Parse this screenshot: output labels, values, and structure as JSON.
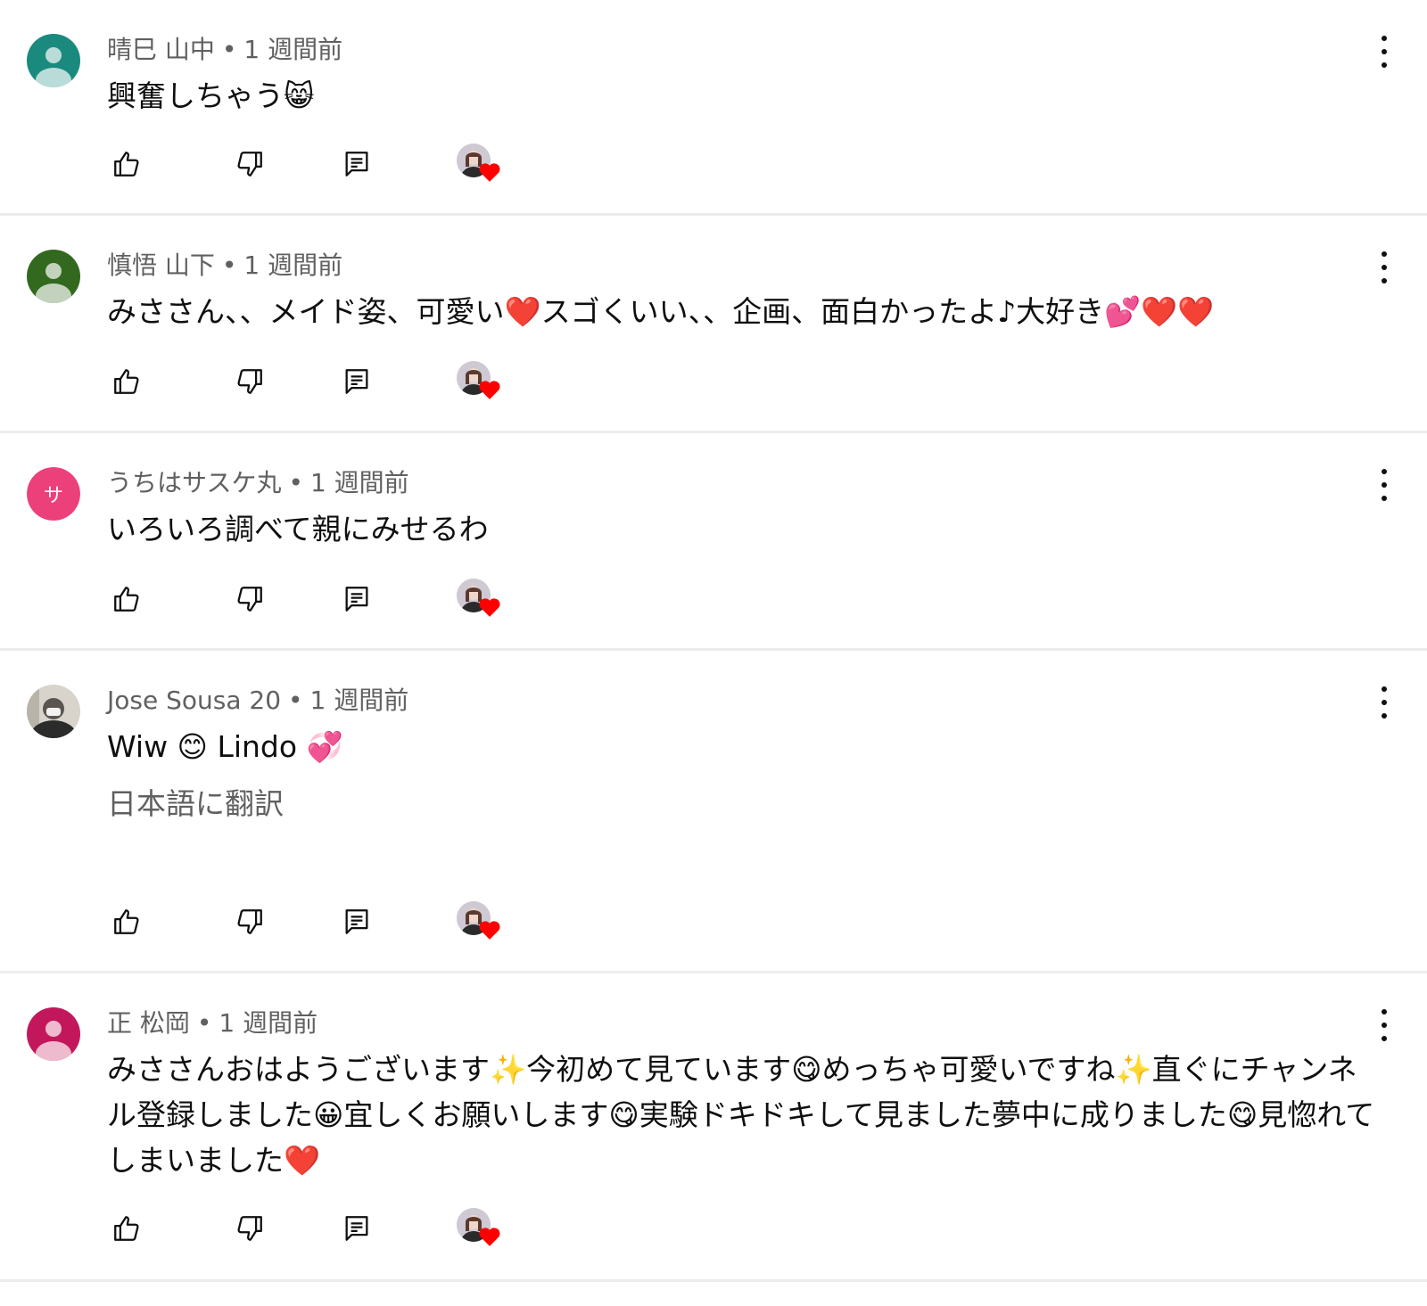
{
  "comments": [
    {
      "author": "晴巳 山中",
      "time": "1 週間前",
      "avatar_type": "person",
      "avatar_color": "#1a8a7e",
      "text": "興奮しちゃう😸",
      "translate": ""
    },
    {
      "author": "慎悟 山下",
      "time": "1 週間前",
      "avatar_type": "person",
      "avatar_color": "#33691e",
      "text": "みささん、、メイド姿、可愛い❤️スゴくいい、、企画、面白かったよ♪大好き💕❤️❤️",
      "translate": ""
    },
    {
      "author": "うちはサスケ丸",
      "time": "1 週間前",
      "avatar_type": "letter",
      "avatar_letter": "サ",
      "avatar_color": "#ec407a",
      "text": "いろいろ調べて親にみせるわ",
      "translate": ""
    },
    {
      "author": "Jose Sousa 20",
      "time": "1 週間前",
      "avatar_type": "photo",
      "avatar_color": "#5a5550",
      "text": "Wiw 😊 Lindo 💞",
      "translate": "日本語に翻訳"
    },
    {
      "author": "正 松岡",
      "time": "1 週間前",
      "avatar_type": "person",
      "avatar_color": "#c2185b",
      "text": "みささんおはようございます✨今初めて見ています😋めっちゃ可愛いですね✨直ぐにチャンネル登録しました😀宜しくお願いします😋実験ドキドキして見ました夢中に成りました😋見惚れてしまいました❤️",
      "translate": ""
    }
  ],
  "separator": "•",
  "icons": {
    "like": "thumb-up-icon",
    "dislike": "thumb-down-icon",
    "reply": "reply-comment-icon",
    "more": "more-vert-icon",
    "creator_heart": "creator-heart-icon"
  },
  "colors": {
    "meta_text": "#606060",
    "body_text": "#0f0f0f",
    "divider": "#ececec",
    "heart": "#ff0000"
  }
}
